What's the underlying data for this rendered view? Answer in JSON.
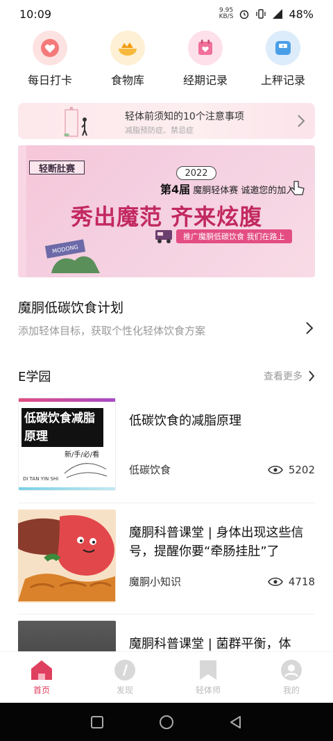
{
  "status_bar": {
    "time": "10:09",
    "net_speed_value": "9.95",
    "net_speed_unit": "KB/S",
    "battery": "48%"
  },
  "quick_entries": [
    {
      "label": "每日打卡",
      "icon": "checkin-heart-icon",
      "color": "#f47a7a"
    },
    {
      "label": "食物库",
      "icon": "food-bowl-icon",
      "color": "#f6b93b"
    },
    {
      "label": "经期记录",
      "icon": "period-calendar-icon",
      "color": "#f0709a"
    },
    {
      "label": "上秤记录",
      "icon": "scale-icon",
      "color": "#4a9ee8"
    }
  ],
  "tips_banner": {
    "title": "轻体前须知的10个注意事项",
    "subtitle": "减脂预防症、禁忌症"
  },
  "promo_banner": {
    "logo": "轻断肚赛",
    "year": "2022",
    "session": "第4届",
    "session_rest": "魔胴轻体赛 诚邀您的加入",
    "headline": "秀出魔范 齐来炫腹",
    "pill": "推广魔胴低碳饮食 我们在路上",
    "sign": "MODONG"
  },
  "diet_plan": {
    "title": "魔胴低碳饮食计划",
    "subtitle": "添加轻体目标，获取个性化轻体饮食方案"
  },
  "e_school": {
    "title": "E学园",
    "more": "查看更多"
  },
  "articles": [
    {
      "title": "低碳饮食的减脂原理",
      "category": "低碳饮食",
      "views": "5202",
      "thumb_line1": "低碳饮食减脂",
      "thumb_line2": "原理",
      "thumb_tag": "新/手/必/看",
      "thumb_foot": "DI TAN YIN SHI"
    },
    {
      "title": "魔胴科普课堂 | 身体出现这些信号，提醒你要“牵肠挂肚”了",
      "category": "魔胴小知识",
      "views": "4718"
    },
    {
      "title": "魔胴科普课堂 | 菌群平衡，体",
      "category": "",
      "views": ""
    }
  ],
  "bottom_nav": [
    {
      "label": "首页",
      "icon": "home-icon",
      "active": true
    },
    {
      "label": "发现",
      "icon": "compass-icon",
      "active": false
    },
    {
      "label": "轻体师",
      "icon": "bookmark-icon",
      "active": false
    },
    {
      "label": "我的",
      "icon": "profile-icon",
      "active": false
    }
  ],
  "colors": {
    "accent": "#e0405f",
    "promo_headline": "#c2295f"
  }
}
